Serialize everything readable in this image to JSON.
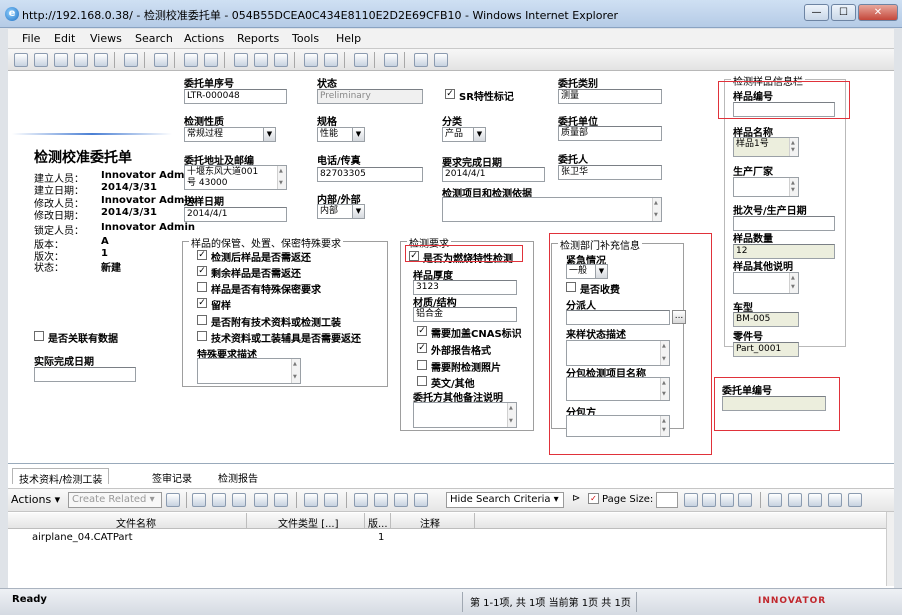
{
  "window": {
    "title": "http://192.168.0.38/ - 检测校准委托单 - 054B55DCEA0C434E8110E2D2E69CFB10 - Windows Internet Explorer",
    "min": "—",
    "max": "☐",
    "close": "✕"
  },
  "menu": [
    "File",
    "Edit",
    "Views",
    "Search",
    "Actions",
    "Reports",
    "Tools",
    "Help"
  ],
  "header": {
    "title": "检测校准委托单",
    "meta": [
      {
        "k": "建立人员：",
        "v": "Innovator Admin"
      },
      {
        "k": "建立日期：",
        "v": "2014/3/31"
      },
      {
        "k": "修改人员：",
        "v": "Innovator Admin"
      },
      {
        "k": "修改日期：",
        "v": "2014/3/31"
      },
      {
        "k": "锁定人员：",
        "v": "Innovator Admin"
      },
      {
        "k": "版本：",
        "v": "A"
      },
      {
        "k": "版次：",
        "v": "1"
      },
      {
        "k": "状态：",
        "v": "新建"
      }
    ],
    "has_related_data": "是否关联有数据",
    "actual_finish_date": "实际完成日期"
  },
  "fields": {
    "order_no": {
      "label": "委托单序号",
      "value": "LTR-000048"
    },
    "status": {
      "label": "状态",
      "value": "Preliminary"
    },
    "sr_flag": {
      "label": "SR特性标记"
    },
    "category": {
      "label": "委托类别",
      "value": "测量"
    },
    "test_nature": {
      "label": "检测性质",
      "value": "常规过程"
    },
    "spec": {
      "label": "规格",
      "value": "性能"
    },
    "classification": {
      "label": "分类",
      "value": "产品"
    },
    "client_unit": {
      "label": "委托单位",
      "value": "质量部"
    },
    "address": {
      "label": "委托地址及邮编",
      "value1": "十堰东风大道001",
      "value2": "号  43000"
    },
    "phone": {
      "label": "电话/传真",
      "value": "82703305"
    },
    "due_date": {
      "label": "要求完成日期",
      "value": "2014/4/1"
    },
    "client": {
      "label": "委托人",
      "value": "张卫华"
    },
    "send_date": {
      "label": "送样日期",
      "value": "2014/4/1"
    },
    "internal_external": {
      "label": "内部/外部",
      "value": "内部"
    },
    "test_items_basis": {
      "label": "检测项目和检测依据"
    }
  },
  "storage": {
    "legend": "样品的保管、处置、保密特殊要求",
    "items": [
      {
        "label": "检测后样品是否需返还",
        "checked": true
      },
      {
        "label": "剩余样品是否需返还",
        "checked": true
      },
      {
        "label": "样品是否有特殊保密要求",
        "checked": false
      },
      {
        "label": "留样",
        "checked": true
      },
      {
        "label": "是否附有技术资料或检测工装",
        "checked": false
      },
      {
        "label": "技术资料或工装辅具是否需要返还",
        "checked": false
      }
    ],
    "special_desc": "特殊要求描述"
  },
  "test_req": {
    "legend": "检测要求",
    "burn_test": "是否为燃烧特性检测",
    "thickness": {
      "label": "样品厚度",
      "value": "3123"
    },
    "material": {
      "label": "材质/结构",
      "value": "铝合金"
    },
    "checks": [
      {
        "label": "需要加盖CNAS标识",
        "checked": true
      },
      {
        "label": "外部报告格式",
        "checked": true
      },
      {
        "label": "需要附检测照片",
        "checked": false
      },
      {
        "label": "英文/其他",
        "checked": false
      }
    ],
    "other_notes": "委托方其他备注说明"
  },
  "dept": {
    "legend": "检测部门补充信息",
    "urgency": {
      "label": "紧急情况",
      "value": "一般"
    },
    "charge": "是否收费",
    "assignee": "分派人",
    "browse": "...",
    "sample_state": "来样状态描述",
    "sub_items": "分包检测项目名称",
    "sub_party": "分包方"
  },
  "sample_info": {
    "legend": "检测样品信息栏",
    "sample_no": {
      "label": "样品编号",
      "value": ""
    },
    "sample_name": {
      "label": "样品名称",
      "value": "样品1号"
    },
    "manufacturer": {
      "label": "生产厂家",
      "value": ""
    },
    "batch": {
      "label": "批次号/生产日期",
      "value": ""
    },
    "qty": {
      "label": "样品数量",
      "value": "12"
    },
    "other": {
      "label": "样品其他说明",
      "value": ""
    },
    "model": {
      "label": "车型",
      "value": "BM-005"
    },
    "part": {
      "label": "零件号",
      "value": "Part_0001"
    }
  },
  "order_number": {
    "label": "委托单编号",
    "value": ""
  },
  "bottom": {
    "tabs": [
      "技术资料/检测工装",
      "签审记录",
      "检测报告"
    ],
    "actions": "Actions",
    "create_related": "Create Related",
    "hide_search": "Hide Search Criteria",
    "page_size": "Page Size:",
    "columns": [
      "文件名称",
      "文件类型 [...]",
      "版...",
      "注释"
    ],
    "rows": [
      {
        "name": "airplane_04.CATPart",
        "type": "",
        "ver": "1",
        "note": ""
      }
    ]
  },
  "status": {
    "left": "Ready",
    "paging": "第 1-1项, 共 1项   当前第 1页 共 1页",
    "brand": "INNOVATOR"
  }
}
